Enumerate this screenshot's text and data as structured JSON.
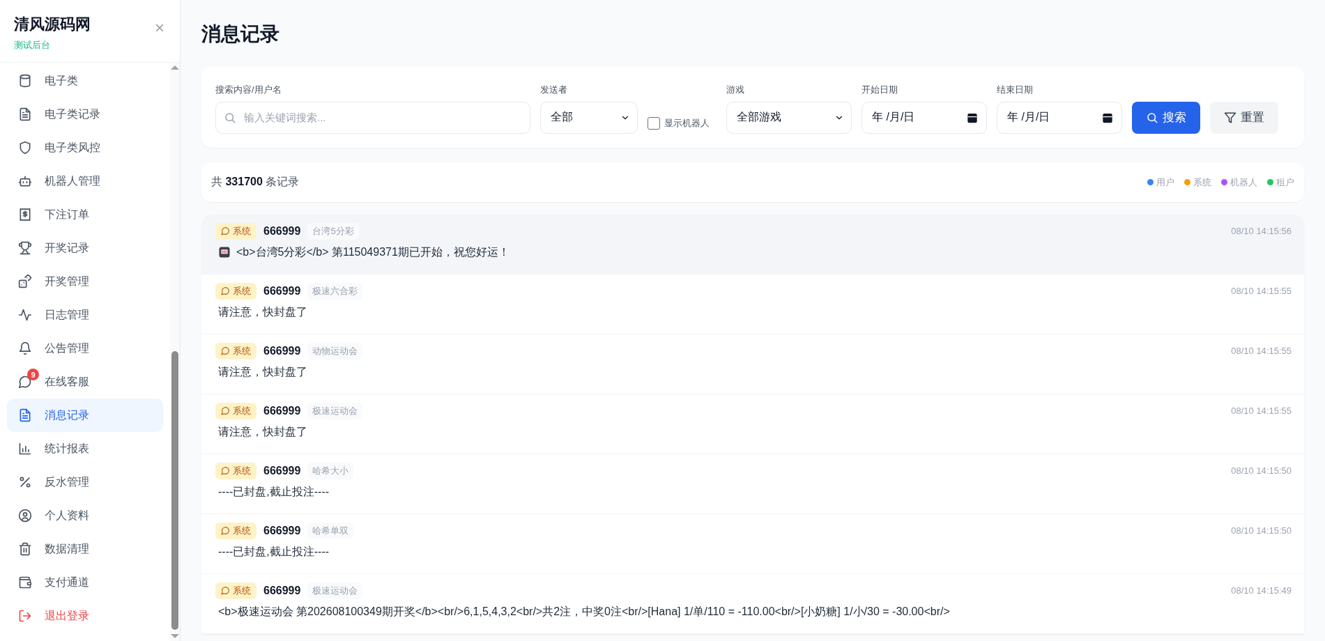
{
  "sidebar": {
    "brand": "清风源码网",
    "subtitle": "测试后台",
    "close": "×",
    "items": [
      {
        "label": "电子类",
        "selected": false,
        "kind": "normal"
      },
      {
        "label": "电子类记录",
        "selected": false,
        "kind": "normal"
      },
      {
        "label": "电子类风控",
        "selected": false,
        "kind": "normal"
      },
      {
        "label": "机器人管理",
        "selected": false,
        "kind": "normal"
      },
      {
        "label": "下注订单",
        "selected": false,
        "kind": "normal"
      },
      {
        "label": "开奖记录",
        "selected": false,
        "kind": "normal"
      },
      {
        "label": "开奖管理",
        "selected": false,
        "kind": "normal"
      },
      {
        "label": "日志管理",
        "selected": false,
        "kind": "normal"
      },
      {
        "label": "公告管理",
        "selected": false,
        "kind": "normal"
      },
      {
        "label": "在线客服",
        "selected": false,
        "kind": "normal",
        "badge": "9"
      },
      {
        "label": "消息记录",
        "selected": true,
        "kind": "normal"
      },
      {
        "label": "统计报表",
        "selected": false,
        "kind": "normal"
      },
      {
        "label": "反水管理",
        "selected": false,
        "kind": "normal"
      },
      {
        "label": "个人资料",
        "selected": false,
        "kind": "normal"
      },
      {
        "label": "数据清理",
        "selected": false,
        "kind": "normal"
      },
      {
        "label": "支付通道",
        "selected": false,
        "kind": "normal"
      },
      {
        "label": "退出登录",
        "selected": false,
        "kind": "logout"
      }
    ]
  },
  "page": {
    "title": "消息记录"
  },
  "filters": {
    "search": {
      "label": "搜索内容/用户名",
      "placeholder": "输入关键词搜索..."
    },
    "sender": {
      "label": "发送者",
      "value": "全部"
    },
    "show_robots": {
      "label": "显示机器人",
      "checked": false
    },
    "game": {
      "label": "游戏",
      "value": "全部游戏"
    },
    "start_date": {
      "label": "开始日期",
      "value": "年 /月/日"
    },
    "end_date": {
      "label": "结束日期",
      "value": "年 /月/日"
    },
    "search_button": "搜索",
    "reset_button": "重置"
  },
  "summary": {
    "prefix": "共",
    "count": "331700",
    "suffix": "条记录"
  },
  "legend": [
    {
      "label": "用户",
      "color": "#3b82f6"
    },
    {
      "label": "系统",
      "color": "#f59e0b"
    },
    {
      "label": "机器人",
      "color": "#a855f7"
    },
    {
      "label": "租户",
      "color": "#22c55e"
    }
  ],
  "messages": [
    {
      "kind": "system",
      "sender": "系统",
      "user": "666999",
      "game": "台湾5分彩",
      "time": "08/10 14:15:56",
      "content": "<b>台湾5分彩</b> 第115049371期已开始，祝您好运！",
      "has_icon": true,
      "highlighted": true
    },
    {
      "kind": "system",
      "sender": "系统",
      "user": "666999",
      "game": "极速六合彩",
      "time": "08/10 14:15:55",
      "content": "请注意，快封盘了",
      "has_icon": false,
      "highlighted": false
    },
    {
      "kind": "system",
      "sender": "系统",
      "user": "666999",
      "game": "动物运动会",
      "time": "08/10 14:15:55",
      "content": "请注意，快封盘了",
      "has_icon": false,
      "highlighted": false
    },
    {
      "kind": "system",
      "sender": "系统",
      "user": "666999",
      "game": "极速运动会",
      "time": "08/10 14:15:55",
      "content": "请注意，快封盘了",
      "has_icon": false,
      "highlighted": false
    },
    {
      "kind": "system",
      "sender": "系统",
      "user": "666999",
      "game": "哈希大小",
      "time": "08/10 14:15:50",
      "content": "----已封盘,截止投注----",
      "has_icon": false,
      "highlighted": false
    },
    {
      "kind": "system",
      "sender": "系统",
      "user": "666999",
      "game": "哈希单双",
      "time": "08/10 14:15:50",
      "content": "----已封盘,截止投注----",
      "has_icon": false,
      "highlighted": false
    },
    {
      "kind": "system",
      "sender": "系统",
      "user": "666999",
      "game": "极速运动会",
      "time": "08/10 14:15:49",
      "content": "<b>极速运动会 第202608100349期开奖</b><br/>6,1,5,4,3,2<br/>共2注，中奖0注<br/>[Hana] 1/单/110 = -110.00<br/>[小奶糖] 1/小/30 = -30.00<br/>",
      "has_icon": false,
      "highlighted": false
    }
  ]
}
